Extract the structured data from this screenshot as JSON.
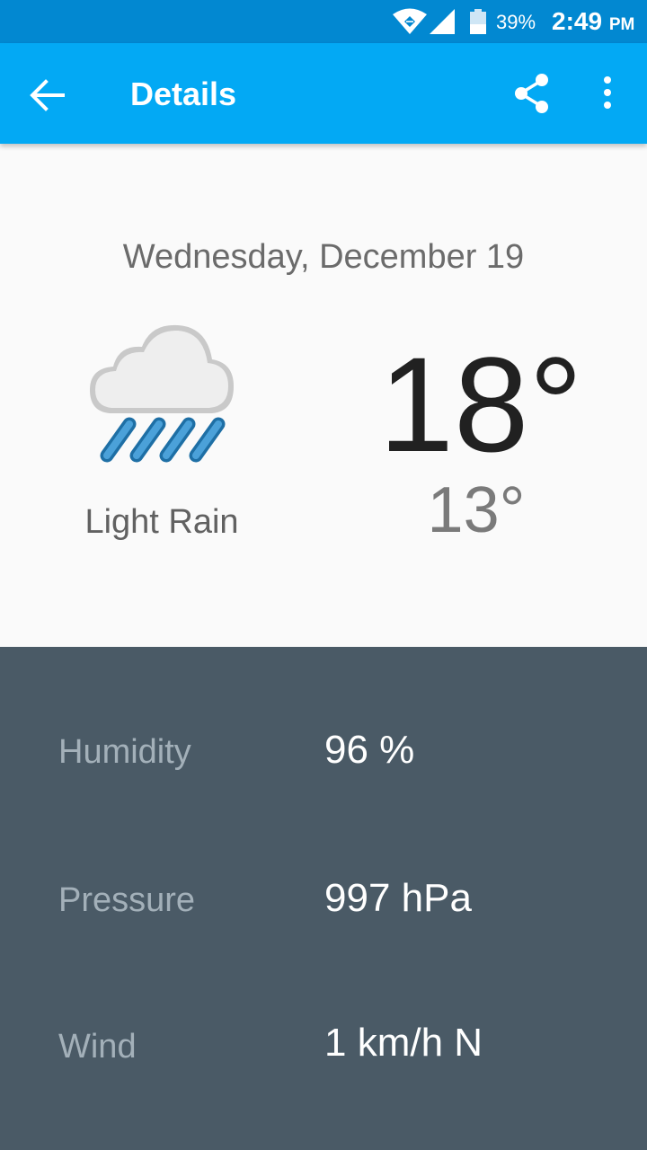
{
  "status_bar": {
    "battery_percent": "39%",
    "time": "2:49",
    "ampm": "PM"
  },
  "app_bar": {
    "title": "Details",
    "back_icon": "arrow-back-icon",
    "share_icon": "share-icon",
    "more_icon": "more-vert-icon"
  },
  "forecast": {
    "date": "Wednesday, December 19",
    "condition": "Light Rain",
    "icon": "light-rain-icon",
    "high": "18°",
    "low": "13°"
  },
  "details": {
    "humidity_label": "Humidity",
    "humidity_value": "96 %",
    "pressure_label": "Pressure",
    "pressure_value": "997 hPa",
    "wind_label": "Wind",
    "wind_value": "1 km/h N"
  },
  "colors": {
    "status_bar": "#0288d1",
    "app_bar": "#03a9f4",
    "details_background": "#4a5a66"
  }
}
